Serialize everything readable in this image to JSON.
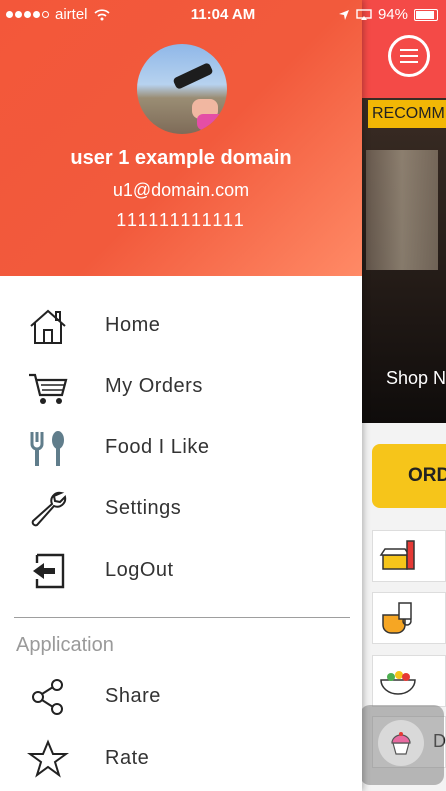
{
  "status_bar": {
    "carrier": "airtel",
    "time": "11:04 AM",
    "battery": "94%"
  },
  "background_app": {
    "banner_label": "RECOMM",
    "shop_label": "Shop N",
    "order_label": "ORD",
    "category_partial_label": "D",
    "brand_color": "#f44a47",
    "accent_color": "#f6c51a"
  },
  "drawer": {
    "user": {
      "name": "user 1 example domain",
      "email": "u1@domain.com",
      "phone": "111111111111"
    },
    "menu": [
      {
        "label": "Home",
        "icon": "home-icon"
      },
      {
        "label": "My Orders",
        "icon": "cart-icon"
      },
      {
        "label": "Food I Like",
        "icon": "fork-spoon-icon"
      },
      {
        "label": "Settings",
        "icon": "wrench-icon"
      },
      {
        "label": "LogOut",
        "icon": "logout-icon"
      }
    ],
    "section_title": "Application",
    "app_menu": [
      {
        "label": "Share",
        "icon": "share-icon"
      },
      {
        "label": "Rate",
        "icon": "star-icon"
      }
    ]
  }
}
